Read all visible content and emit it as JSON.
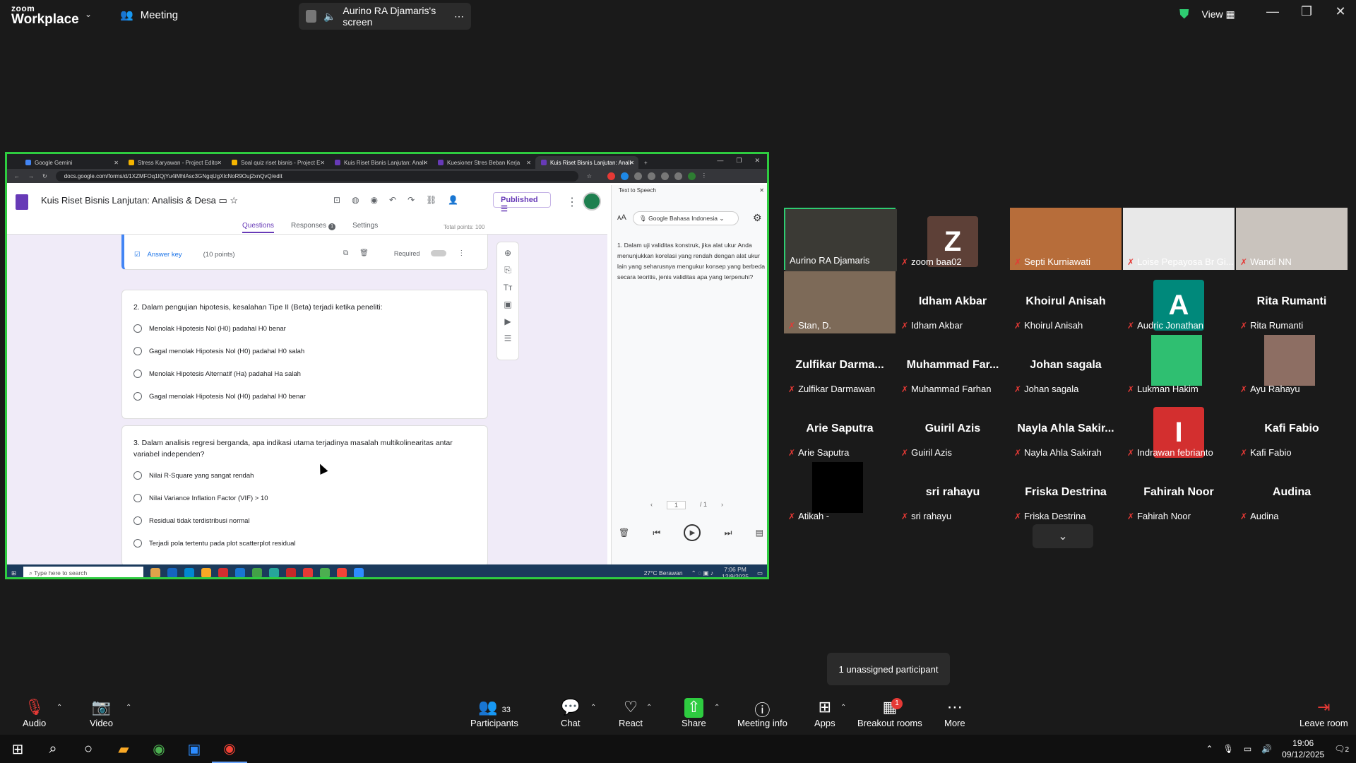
{
  "zoom": {
    "brand_top": "zoom",
    "brand_bottom": "Workplace",
    "meeting_label": "Meeting",
    "share_title": "Aurino RA Djamaris's screen",
    "view_label": "View",
    "accent": "#2ecc40"
  },
  "browser": {
    "tabs": [
      "Google Gemini",
      "Stress Karyawan - Project Edito",
      "Soal quiz riset bisnis - Project E",
      "Kuis Riset Bisnis Lanjutan: Anali",
      "Kuesioner Stres Beban Kerja",
      "Kuis Riset Bisnis Lanjutan: Anali"
    ],
    "url": "docs.google.com/forms/d/1XZMFOq1IQjYu4iMhlAsc3GNgqUgXlcNoR9Ouj2xnQvQ/edit"
  },
  "form": {
    "title": "Kuis Riset Bisnis Lanjutan: Analisis & Desa",
    "published": "Published",
    "tabs": [
      "Questions",
      "Responses",
      "Settings"
    ],
    "responses_count": "1",
    "total_points": "Total points: 100",
    "answer_key": "Answer key",
    "points": "(10 points)",
    "required": "Required",
    "q2": "2. Dalam pengujian hipotesis, kesalahan Tipe II (Beta) terjadi ketika peneliti:",
    "q2_opts": [
      "Menolak Hipotesis Nol (H0) padahal H0 benar",
      "Gagal menolak Hipotesis Nol (H0) padahal H0 salah",
      "Menolak Hipotesis Alternatif (Ha) padahal Ha salah",
      "Gagal menolak Hipotesis Nol (H0) padahal H0 benar"
    ],
    "q3": "3. Dalam analisis regresi berganda, apa indikasi utama terjadinya masalah multikolinearitas antar variabel independen?",
    "q3_opts": [
      "Nilai R-Square yang sangat rendah",
      "Nilai Variance Inflation Factor (VIF) > 10",
      "Residual tidak terdistribusi normal",
      "Terjadi pola tertentu pada plot scatterplot residual"
    ]
  },
  "tts": {
    "title": "Text to Speech",
    "lang": "Google Bahasa Indonesia",
    "text": "1. Dalam uji validitas konstruk, jika alat ukur Anda menunjukkan korelasi yang rendah dengan alat ukur lain yang seharusnya mengukur konsep yang berbeda secara teoritis, jenis validitas apa yang terpenuhi?",
    "page": "1",
    "of": "/ 1"
  },
  "win_inner": {
    "search": "Type here to search",
    "weather": "27°C Berawan",
    "time": "7:06 PM",
    "date": "12/9/2025"
  },
  "participants": [
    {
      "big": "",
      "name": "Aurino RA Djamaris",
      "photo": "#3b3a35"
    },
    {
      "big": "",
      "name": "zoom baa02",
      "letter": "Z",
      "lcolor": "#5d4037"
    },
    {
      "big": "",
      "name": "Septi Kurniawati",
      "photo": "#b76d3a"
    },
    {
      "big": "",
      "name": "Loise Pepayosa Br Gi...",
      "photo": "#e8e8e8"
    },
    {
      "big": "",
      "name": "Wandi NN",
      "photo": "#c9c3bd"
    },
    {
      "big": "",
      "name": "Stan, D.",
      "photo": "#7d6a58"
    },
    {
      "big": "Idham Akbar",
      "name": "Idham Akbar"
    },
    {
      "big": "Khoirul Anisah",
      "name": "Khoirul Anisah"
    },
    {
      "big": "",
      "name": "Audric Jonathan",
      "letter": "A",
      "lcolor": "#00897b"
    },
    {
      "big": "Rita Rumanti",
      "name": "Rita Rumanti"
    },
    {
      "big": "Zulfikar  Darma...",
      "name": "Zulfikar Darmawan"
    },
    {
      "big": "Muhammad Far...",
      "name": "Muhammad Farhan"
    },
    {
      "big": "Johan sagala",
      "name": "Johan sagala"
    },
    {
      "big": "",
      "name": "Lukman Hakim",
      "photo": "#2fbf71"
    },
    {
      "big": "",
      "name": "Ayu Rahayu",
      "photo": "#8d6e63"
    },
    {
      "big": "Arie Saputra",
      "name": "Arie Saputra"
    },
    {
      "big": "Guiril Azis",
      "name": "Guiril Azis"
    },
    {
      "big": "Nayla Ahla Sakir...",
      "name": "Nayla Ahla Sakirah"
    },
    {
      "big": "",
      "name": "Indrawan febrianto",
      "letter": "I",
      "lcolor": "#d32f2f"
    },
    {
      "big": "Kafi Fabio",
      "name": "Kafi Fabio"
    },
    {
      "big": "",
      "name": "Atikah -",
      "photo": "#000000"
    },
    {
      "big": "sri rahayu",
      "name": "sri rahayu"
    },
    {
      "big": "Friska Destrina",
      "name": "Friska Destrina"
    },
    {
      "big": "Fahirah Noor",
      "name": "Fahirah Noor"
    },
    {
      "big": "Audina",
      "name": "Audina"
    }
  ],
  "tooltip": "1 unassigned participant",
  "toolbar": {
    "audio": "Audio",
    "video": "Video",
    "participants": "Participants",
    "participants_count": "33",
    "chat": "Chat",
    "react": "React",
    "share": "Share",
    "meeting_info": "Meeting info",
    "apps": "Apps",
    "breakout": "Breakout rooms",
    "breakout_badge": "1",
    "more": "More",
    "leave": "Leave room"
  },
  "taskbar": {
    "time": "19:06",
    "date": "09/12/2025",
    "notif": "2"
  }
}
